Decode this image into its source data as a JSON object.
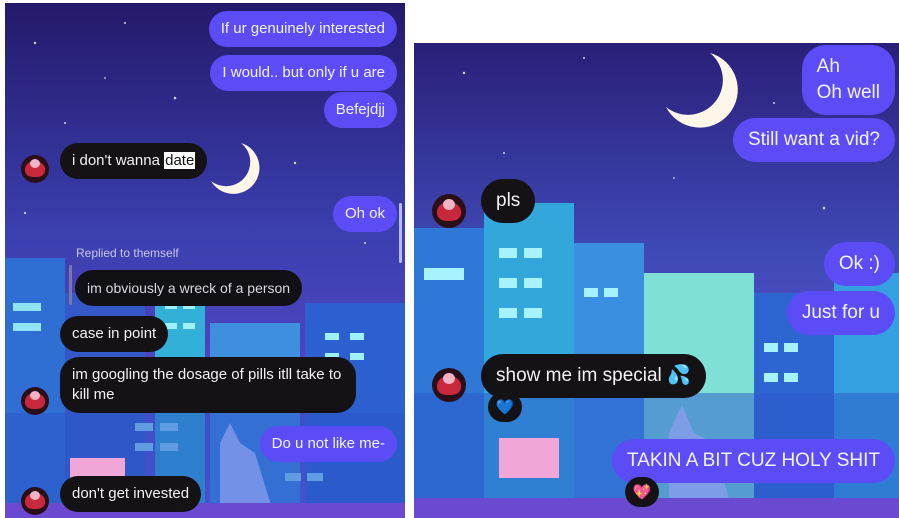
{
  "left_chat": {
    "messages": {
      "m1": "If ur genuinely interested",
      "m2": "I would.. but only if u are",
      "m3": "Befejdjj",
      "m4_text": "i don't wanna ",
      "m4_highlight": "date",
      "m5": "Oh ok",
      "replied_label": "Replied to themself",
      "reply_quote": "im obviously a wreck of a person",
      "m6": "case in point",
      "m7": "im googling the dosage of pills itll take to kill me",
      "m8": "Do u not like me-",
      "m9": "don't get invested"
    }
  },
  "right_chat": {
    "messages": {
      "r1_line1": "Ah",
      "r1_line2": "Oh well",
      "r2": "Still want a vid?",
      "r3": "pls",
      "r4": "Ok :)",
      "r5": "Just for u",
      "r6": "show me im special",
      "r6_emoji": "💦",
      "r6_reaction": "💙",
      "r7": "TAKIN A BIT CUZ HOLY SHIT",
      "r7_reaction": "💖"
    }
  },
  "colors": {
    "outgoing_bubble": "#5b4cf6",
    "incoming_bubble": "#141214",
    "sky_top": "#241a6a",
    "sky_bottom": "#7b4fd6"
  }
}
